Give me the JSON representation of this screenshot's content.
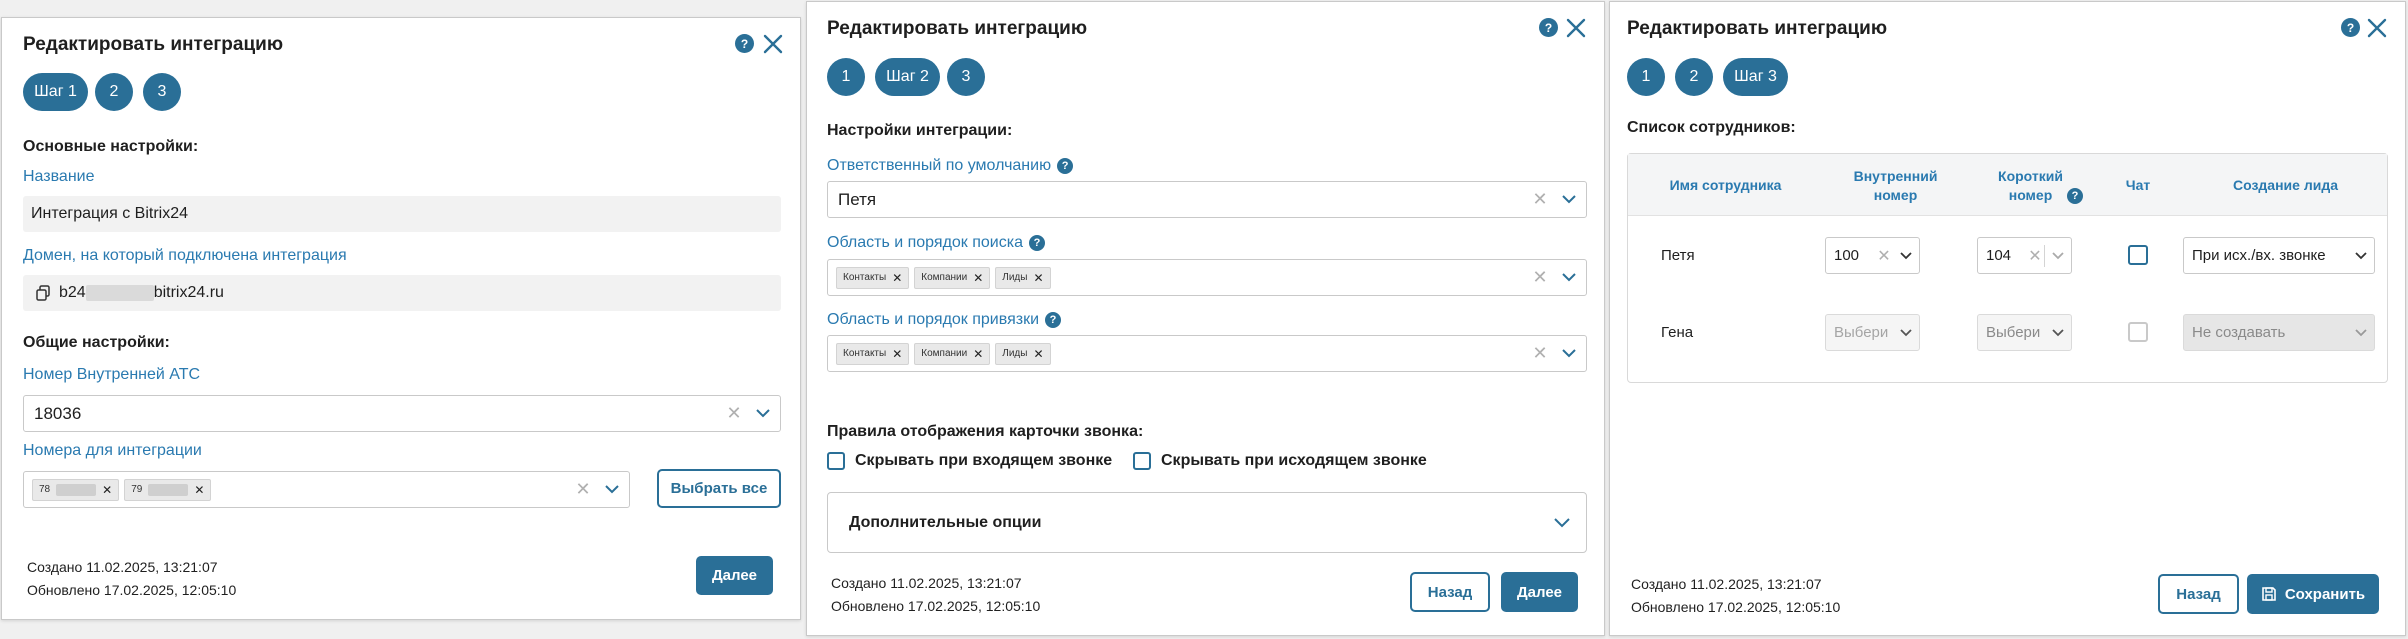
{
  "dialogs": [
    {
      "title": "Редактировать интеграцию",
      "help": "?",
      "steps": [
        "Шаг 1",
        "2",
        "3"
      ],
      "main_settings": {
        "heading": "Основные настройки:",
        "name_label": "Название",
        "name_value": "Интеграция с Bitrix24",
        "domain_label": "Домен, на который подключена интеграция",
        "domain_prefix": "b24",
        "domain_suffix": "bitrix24.ru"
      },
      "general_settings": {
        "heading": "Общие настройки:",
        "pbx_label": "Номер Внутренней АТС",
        "pbx_value": "18036",
        "numbers_label": "Номера для интеграции",
        "number_chips": [
          "78",
          "79"
        ],
        "select_all": "Выбрать все"
      },
      "meta": {
        "created": "Создано 11.02.2025, 13:21:07",
        "updated": "Обновлено 17.02.2025, 12:05:10"
      },
      "next_button": "Далее"
    },
    {
      "title": "Редактировать интеграцию",
      "help": "?",
      "steps": [
        "1",
        "Шаг 2",
        "3"
      ],
      "settings_heading": "Настройки интеграции:",
      "responsible_label": "Ответственный по умолчанию",
      "responsible_value": "Петя",
      "search_label": "Область и порядок поиска",
      "search_chips": [
        "Контакты",
        "Компании",
        "Лиды"
      ],
      "binding_label": "Область и порядок привязки",
      "binding_chips": [
        "Контакты",
        "Компании",
        "Лиды"
      ],
      "card_rules_heading": "Правила отображения карточки звонка:",
      "hide_incoming": "Скрывать при входящем звонке",
      "hide_outgoing": "Скрывать при исходящем звонке",
      "extra_options": "Дополнительные опции",
      "meta": {
        "created": "Создано 11.02.2025, 13:21:07",
        "updated": "Обновлено 17.02.2025, 12:05:10"
      },
      "back_button": "Назад",
      "next_button": "Далее"
    },
    {
      "title": "Редактировать интеграцию",
      "help": "?",
      "steps": [
        "1",
        "2",
        "Шаг 3"
      ],
      "list_heading": "Список сотрудников:",
      "columns": {
        "name": "Имя сотрудника",
        "internal": [
          "Внутренний",
          "номер"
        ],
        "short": [
          "Короткий",
          "номер"
        ],
        "chat": "Чат",
        "lead": "Создание лида"
      },
      "rows": [
        {
          "name": "Петя",
          "internal": "100",
          "short": "104",
          "chat": false,
          "lead": "При исх./вх. звонке"
        },
        {
          "name": "Гена",
          "internal": "Выбери",
          "short": "Выбери",
          "chat": false,
          "lead": "Не создавать"
        }
      ],
      "meta": {
        "created": "Создано 11.02.2025, 13:21:07",
        "updated": "Обновлено 17.02.2025, 12:05:10"
      },
      "back_button": "Назад",
      "save_button": "Сохранить"
    }
  ],
  "colors": {
    "accent": "#2a6f97",
    "link": "#2a7ab0",
    "background": "#f0f0f0"
  },
  "icons": [
    "help-icon",
    "close-icon",
    "chevron-down-icon",
    "copy-icon",
    "save-icon"
  ]
}
